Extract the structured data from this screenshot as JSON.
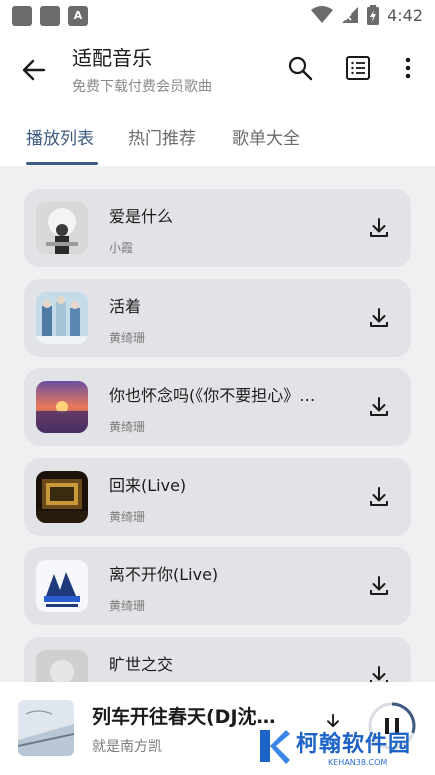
{
  "status_bar": {
    "time": "4:42"
  },
  "app_bar": {
    "title": "适配音乐",
    "subtitle": "免费下载付费会员歌曲"
  },
  "tabs": [
    {
      "label": "播放列表",
      "active": true
    },
    {
      "label": "热门推荐",
      "active": false
    },
    {
      "label": "歌单大全",
      "active": false
    }
  ],
  "songs": [
    {
      "title": "爱是什么",
      "artist": "小霞"
    },
    {
      "title": "活着",
      "artist": "黄绮珊"
    },
    {
      "title": "你也怀念吗(《你不要担心》…",
      "artist": "黄绮珊"
    },
    {
      "title": "回来(Live)",
      "artist": "黄绮珊"
    },
    {
      "title": "离不开你(Live)",
      "artist": "黄绮珊"
    },
    {
      "title": "旷世之交",
      "artist": ""
    }
  ],
  "now_playing": {
    "title": "列车开往春天(DJ沈…",
    "artist": "就是南方凯",
    "progress": 0.3
  },
  "watermark": {
    "name": "柯翰软件园",
    "url": "KEHAN38.COM"
  },
  "colors": {
    "accent": "#3d5a80",
    "card": "#e2e3e6",
    "list_bg": "#f0f0f2",
    "watermark": "#1e63c8"
  }
}
